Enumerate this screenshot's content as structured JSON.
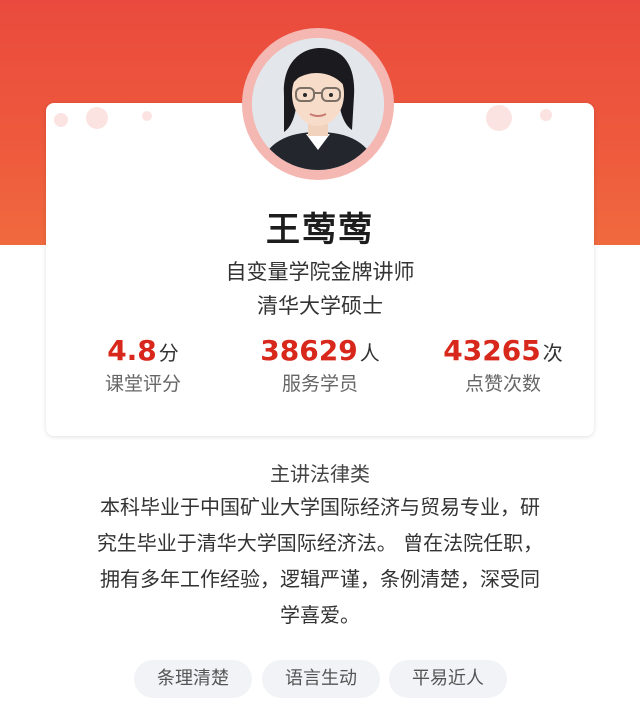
{
  "teacher": {
    "name": "王莺莺",
    "title_line1": "自变量学院金牌讲师",
    "title_line2": "清华大学硕士"
  },
  "stats": [
    {
      "value": "4.8",
      "unit": "分",
      "label": "课堂评分"
    },
    {
      "value": "38629",
      "unit": "人",
      "label": "服务学员"
    },
    {
      "value": "43265",
      "unit": "次",
      "label": "点赞次数"
    }
  ],
  "subject": "主讲法律类",
  "bio_lines": [
    "本科毕业于中国矿业大学国际经济与贸易专业，研",
    "究生毕业于清华大学国际经济法。 曾在法院任职，",
    "拥有多年工作经验，逻辑严谨，条例清楚，深受同",
    "学喜爱。"
  ],
  "tags": [
    "条理清楚",
    "语言生动",
    "平易近人"
  ],
  "colors": {
    "hero": "#ea4a3d",
    "accent_number": "#d8271b",
    "tag_bg": "#f1f3f6"
  }
}
